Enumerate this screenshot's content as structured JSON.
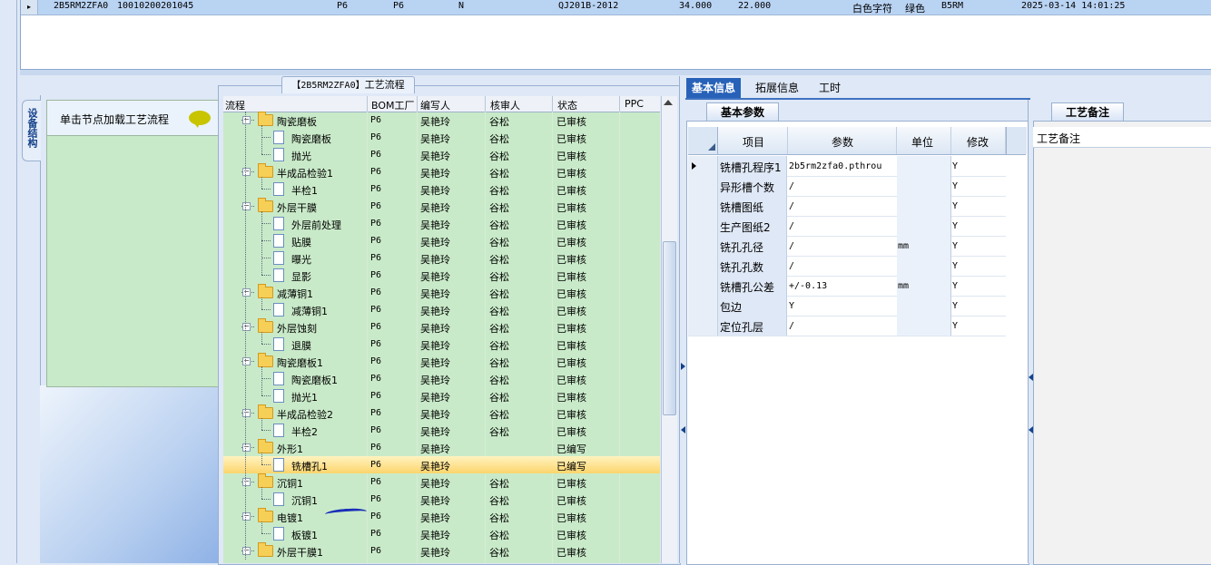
{
  "top_grid": {
    "row": {
      "indicator": "▸",
      "part_no": "2B5RM2ZFA0",
      "code": "10010200201045",
      "col3": "P6",
      "col4": "P6",
      "col5": "N",
      "standard": "QJ201B-2012",
      "val1": "34.000",
      "val2": "22.000",
      "text_color": "白色字符",
      "mask_color": "绿色",
      "version": "B5RM",
      "datetime": "2025-03-14 14:01:25"
    }
  },
  "left_panel": {
    "vertical_tab": "设备结构",
    "load_hint": "单击节点加载工艺流程"
  },
  "tree": {
    "title_code": "【2B5RM2ZFA0】",
    "title_text": "工艺流程",
    "headers": [
      "流程",
      "BOM工厂",
      "编写人",
      "核审人",
      "状态",
      "PPC"
    ],
    "rows": [
      {
        "name": "陶瓷磨板",
        "level": 1,
        "bom": "P6",
        "writer": "吴艳玲",
        "reviewer": "谷松",
        "status": "已审核"
      },
      {
        "name": "陶瓷磨板",
        "level": 2,
        "bom": "P6",
        "writer": "吴艳玲",
        "reviewer": "谷松",
        "status": "已审核"
      },
      {
        "name": "抛光",
        "level": 2,
        "bom": "P6",
        "writer": "吴艳玲",
        "reviewer": "谷松",
        "status": "已审核"
      },
      {
        "name": "半成品检验1",
        "level": 1,
        "bom": "P6",
        "writer": "吴艳玲",
        "reviewer": "谷松",
        "status": "已审核"
      },
      {
        "name": "半检1",
        "level": 2,
        "bom": "P6",
        "writer": "吴艳玲",
        "reviewer": "谷松",
        "status": "已审核"
      },
      {
        "name": "外层干膜",
        "level": 1,
        "bom": "P6",
        "writer": "吴艳玲",
        "reviewer": "谷松",
        "status": "已审核"
      },
      {
        "name": "外层前处理",
        "level": 2,
        "bom": "P6",
        "writer": "吴艳玲",
        "reviewer": "谷松",
        "status": "已审核"
      },
      {
        "name": "贴膜",
        "level": 2,
        "bom": "P6",
        "writer": "吴艳玲",
        "reviewer": "谷松",
        "status": "已审核"
      },
      {
        "name": "曝光",
        "level": 2,
        "bom": "P6",
        "writer": "吴艳玲",
        "reviewer": "谷松",
        "status": "已审核"
      },
      {
        "name": "显影",
        "level": 2,
        "bom": "P6",
        "writer": "吴艳玲",
        "reviewer": "谷松",
        "status": "已审核"
      },
      {
        "name": "减薄铜1",
        "level": 1,
        "bom": "P6",
        "writer": "吴艳玲",
        "reviewer": "谷松",
        "status": "已审核"
      },
      {
        "name": "减薄铜1",
        "level": 2,
        "bom": "P6",
        "writer": "吴艳玲",
        "reviewer": "谷松",
        "status": "已审核"
      },
      {
        "name": "外层蚀刻",
        "level": 1,
        "bom": "P6",
        "writer": "吴艳玲",
        "reviewer": "谷松",
        "status": "已审核"
      },
      {
        "name": "退膜",
        "level": 2,
        "bom": "P6",
        "writer": "吴艳玲",
        "reviewer": "谷松",
        "status": "已审核"
      },
      {
        "name": "陶瓷磨板1",
        "level": 1,
        "bom": "P6",
        "writer": "吴艳玲",
        "reviewer": "谷松",
        "status": "已审核"
      },
      {
        "name": "陶瓷磨板1",
        "level": 2,
        "bom": "P6",
        "writer": "吴艳玲",
        "reviewer": "谷松",
        "status": "已审核"
      },
      {
        "name": "抛光1",
        "level": 2,
        "bom": "P6",
        "writer": "吴艳玲",
        "reviewer": "谷松",
        "status": "已审核"
      },
      {
        "name": "半成品检验2",
        "level": 1,
        "bom": "P6",
        "writer": "吴艳玲",
        "reviewer": "谷松",
        "status": "已审核"
      },
      {
        "name": "半检2",
        "level": 2,
        "bom": "P6",
        "writer": "吴艳玲",
        "reviewer": "谷松",
        "status": "已审核"
      },
      {
        "name": "外形1",
        "level": 1,
        "bom": "P6",
        "writer": "吴艳玲",
        "reviewer": "",
        "status": "已编写"
      },
      {
        "name": "铣槽孔1",
        "level": 2,
        "bom": "P6",
        "writer": "吴艳玲",
        "reviewer": "",
        "status": "已编写",
        "selected": true
      },
      {
        "name": "沉铜1",
        "level": 1,
        "bom": "P6",
        "writer": "吴艳玲",
        "reviewer": "谷松",
        "status": "已审核"
      },
      {
        "name": "沉铜1",
        "level": 2,
        "bom": "P6",
        "writer": "吴艳玲",
        "reviewer": "谷松",
        "status": "已审核"
      },
      {
        "name": "电镀1",
        "level": 1,
        "bom": "P6",
        "writer": "吴艳玲",
        "reviewer": "谷松",
        "status": "已审核"
      },
      {
        "name": "板镀1",
        "level": 2,
        "bom": "P6",
        "writer": "吴艳玲",
        "reviewer": "谷松",
        "status": "已审核"
      },
      {
        "name": "外层干膜1",
        "level": 1,
        "bom": "P6",
        "writer": "吴艳玲",
        "reviewer": "谷松",
        "status": "已审核"
      }
    ]
  },
  "right_panel": {
    "tabs": [
      "基本信息",
      "拓展信息",
      "工时"
    ],
    "params_tab": "基本参数",
    "grid_headers": [
      "项目",
      "参数",
      "单位",
      "修改"
    ],
    "params": [
      {
        "item": "铣槽孔程序1",
        "value": "2b5rm2zfa0.pthrou",
        "unit": "",
        "modify": "Y",
        "current": true
      },
      {
        "item": "异形槽个数",
        "value": "/",
        "unit": "",
        "modify": "Y"
      },
      {
        "item": "铣槽图纸",
        "value": "/",
        "unit": "",
        "modify": "Y"
      },
      {
        "item": "生产图纸2",
        "value": "/",
        "unit": "",
        "modify": "Y"
      },
      {
        "item": "铣孔孔径",
        "value": "/",
        "unit": "mm",
        "modify": "Y"
      },
      {
        "item": "铣孔孔数",
        "value": "/",
        "unit": "",
        "modify": "Y"
      },
      {
        "item": "铣槽孔公差",
        "value": "+/-0.13",
        "unit": "mm",
        "modify": "Y"
      },
      {
        "item": "包边",
        "value": "Y",
        "unit": "",
        "modify": "Y"
      },
      {
        "item": "定位孔层",
        "value": "/",
        "unit": "",
        "modify": "Y"
      }
    ],
    "notes_tab": "工艺备注",
    "notes_label": "工艺备注"
  },
  "colors": {
    "selected_tab": "#2862b8",
    "tree_bg": "#c9eac9",
    "selected_row": "#fcd56c",
    "pen_mark": "#1a2fb8"
  }
}
